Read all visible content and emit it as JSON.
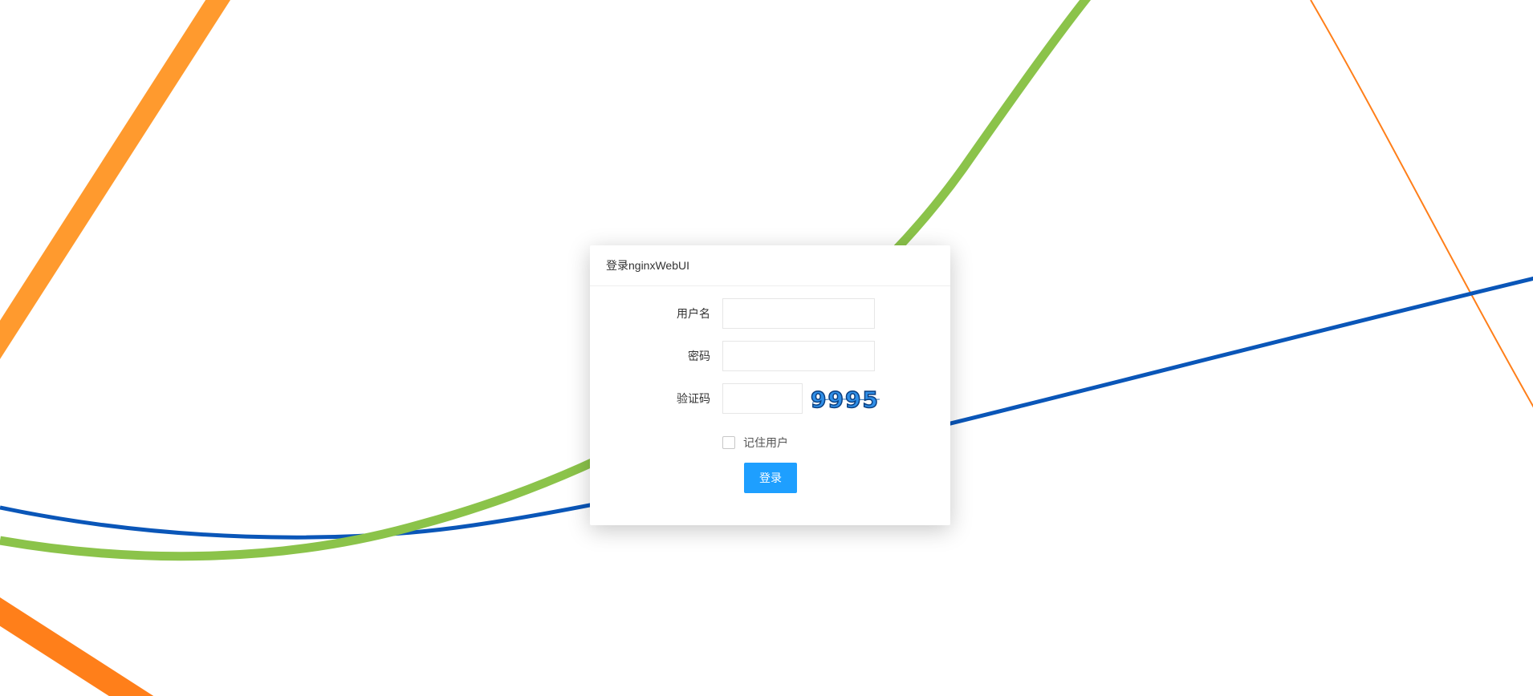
{
  "background": {
    "colors": {
      "orange": "#ff9a2e",
      "orange_dark": "#ff7f1a",
      "orange_thin": "#ff7f1a",
      "green": "#8bc34a",
      "blue": "#0a56b8"
    }
  },
  "login": {
    "title": "登录nginxWebUI",
    "username_label": "用户名",
    "username_value": "",
    "password_label": "密码",
    "password_value": "",
    "captcha_label": "验证码",
    "captcha_value": "",
    "captcha_text": "9995",
    "remember_label": "记住用户",
    "remember_checked": false,
    "submit_label": "登录",
    "accent_color": "#1e9fff"
  }
}
